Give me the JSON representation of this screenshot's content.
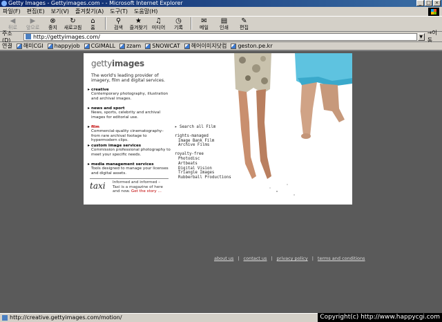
{
  "window": {
    "title": "Getty Images - Gettyimages.com - - Microsoft Internet Explorer",
    "controls": [
      "_",
      "□",
      "×"
    ]
  },
  "menu": [
    "파일(F)",
    "편집(E)",
    "보기(V)",
    "즐겨찾기(A)",
    "도구(T)",
    "도움말(H)"
  ],
  "toolbar": {
    "back": "뒤로",
    "forward": "앞으로",
    "stop": "중지",
    "refresh": "새로고침",
    "home": "홈",
    "search": "검색",
    "favorites": "즐겨찾기",
    "media": "미디어",
    "history": "기록",
    "mail": "메일",
    "print": "인쇄",
    "edit": "편집"
  },
  "address": {
    "label": "주소(D)",
    "url": "http://gettyimages.com/",
    "go": "이동"
  },
  "links": {
    "label": "연결",
    "items": [
      "해미CGI",
      "happyjob",
      "CGIMALL",
      "zzam",
      "SNOWCAT",
      "헤어이미지닷컴",
      "geston.pe.kr"
    ]
  },
  "page": {
    "logo_light": "getty",
    "logo_bold": "images",
    "tagline": "The world's leading provider of imagery, film and digital services.",
    "sections": [
      {
        "title": "creative",
        "desc": "Contemporary photography, illustration and archival images.",
        "highlight": false
      },
      {
        "title": "news and sport",
        "desc": "News, sports, celebrity and archival images for editorial use.",
        "highlight": false
      },
      {
        "title": "film",
        "desc": "Commercial-quality cinematography–from rare archival footage to hypermodern clips.",
        "highlight": true
      },
      {
        "title": "custom image services",
        "desc": "Commission professional photography to meet your specific needs.",
        "highlight": false
      },
      {
        "title": "media management services",
        "desc": "Tools designed to manage your licenses and digital assets.",
        "highlight": false
      }
    ],
    "film_menu": {
      "search_all": "Search all Film",
      "rights_managed": "rights-managed",
      "rights_items": [
        "Image Bank Film",
        "Archive Films"
      ],
      "royalty_free": "royalty-free",
      "royalty_items": [
        "Photodisc",
        "Artbeats",
        "Digital Vision",
        "Triangle Images",
        "Rubberball Productions"
      ]
    },
    "informed": {
      "mark": "taxi",
      "line1": "Informed and informed –",
      "line2": "Taxi is a magazine of here and now.",
      "cta": "Get the story ..."
    },
    "footer_links": [
      "about us",
      "contact us",
      "privacy policy",
      "terms and conditions"
    ],
    "sep": "|"
  },
  "status": {
    "url": "http://creative.gettyimages.com/motion/",
    "watermark": "Copyright(c) http://www.happycgi.com"
  },
  "colors": {
    "title_bar": "#0a246a",
    "chrome": "#d4d0c8",
    "page_bg": "#5a5a5a",
    "highlight": "#c00000"
  }
}
